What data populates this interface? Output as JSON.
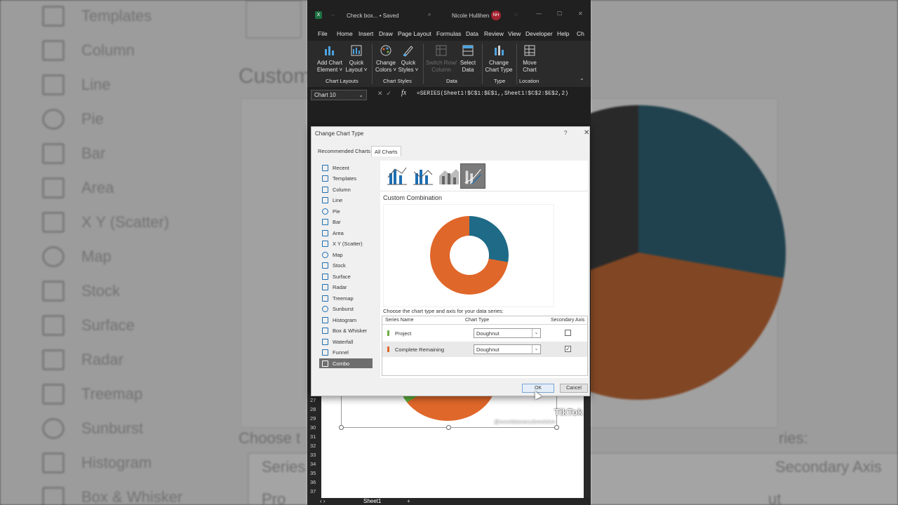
{
  "background": {
    "left_items": [
      "Templates",
      "Column",
      "Line",
      "Pie",
      "Bar",
      "Area",
      "X Y (Scatter)",
      "Map",
      "Stock",
      "Surface",
      "Radar",
      "Treemap",
      "Sunburst",
      "Histogram",
      "Box & Whisker"
    ],
    "title_partial": "Custom",
    "choose_partial": "Choose t",
    "series_partial": "ries:",
    "table_header_left": "Series N",
    "table_header_right": "Secondary Axis",
    "table_row_left": "Pro",
    "table_row_right": "ut"
  },
  "titlebar": {
    "doc_name": "Check box... • Saved",
    "user_name": "Nicole Hullihen",
    "avatar_initials": "NH",
    "excel_logo": "X"
  },
  "menu": [
    "File",
    "Home",
    "Insert",
    "Draw",
    "Page Layout",
    "Formulas",
    "Data",
    "Review",
    "View",
    "Developer",
    "Help",
    "Ch"
  ],
  "ribbon": {
    "buttons": [
      {
        "label1": "Add Chart",
        "label2": "Element ˅"
      },
      {
        "label1": "Quick",
        "label2": "Layout ˅"
      },
      {
        "label1": "Change",
        "label2": "Colors ˅"
      },
      {
        "label1": "Quick",
        "label2": "Styles ˅"
      },
      {
        "label1": "Switch Row/",
        "label2": "Column"
      },
      {
        "label1": "Select",
        "label2": "Data"
      },
      {
        "label1": "Change",
        "label2": "Chart Type"
      },
      {
        "label1": "Move",
        "label2": "Chart"
      }
    ],
    "groups": [
      "Chart Layouts",
      "Chart Styles",
      "Data",
      "Type",
      "Location"
    ]
  },
  "formula_bar": {
    "name_box": "Chart 10",
    "fx": "fx",
    "formula": "=SERIES(Sheet1!$C$1:$E$1,,Sheet1!$C$2:$E$2,2)"
  },
  "sheet": {
    "row_numbers": [
      "27",
      "28",
      "29",
      "30",
      "31",
      "32",
      "33",
      "34",
      "35",
      "36",
      "37"
    ],
    "tab_name": "Sheet1",
    "add_sheet": "+",
    "watermark_brand": "TikTok",
    "watermark_handle": "@excelatexecutivevision"
  },
  "dialog": {
    "title": "Change Chart Type",
    "help": "?",
    "close": "✕",
    "tabs": [
      "Recommended Charts",
      "All Charts"
    ],
    "categories": [
      "Recent",
      "Templates",
      "Column",
      "Line",
      "Pie",
      "Bar",
      "Area",
      "X Y (Scatter)",
      "Map",
      "Stock",
      "Surface",
      "Radar",
      "Treemap",
      "Sunburst",
      "Histogram",
      "Box & Whisker",
      "Waterfall",
      "Funnel",
      "Combo"
    ],
    "selected_category": "Combo",
    "combo_title": "Custom Combination",
    "choose_text": "Choose the chart type and axis for your data series:",
    "table_headers": [
      "Series Name",
      "Chart Type",
      "Secondary Axis"
    ],
    "series": [
      {
        "name": "Project",
        "color": "#70ad47",
        "chart_type": "Doughnut",
        "secondary_axis": false
      },
      {
        "name": "Complete Remaining",
        "color": "#e0672a",
        "chart_type": "Doughnut",
        "secondary_axis": true
      }
    ],
    "preview_colors": {
      "segment_1": "#1e6a87",
      "segment_2": "#e0672a"
    },
    "ok_label": "OK",
    "cancel_label": "Cancel"
  }
}
